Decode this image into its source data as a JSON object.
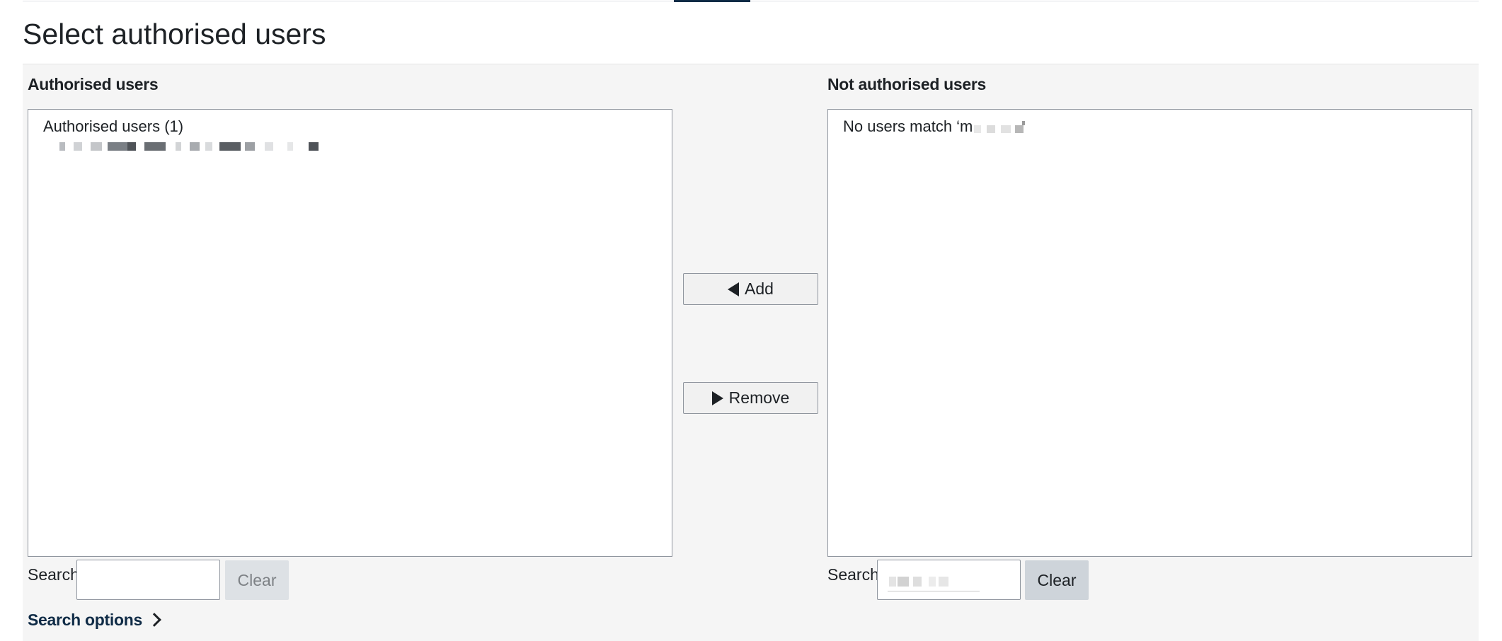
{
  "page": {
    "title": "Select authorised users"
  },
  "authorised": {
    "heading": "Authorised users",
    "group_label": "Authorised users (1)",
    "search_label": "Search",
    "search_value": "",
    "clear_label": "Clear"
  },
  "not_authorised": {
    "heading": "Not authorised users",
    "no_match_prefix": "No users match ‘m",
    "search_label": "Search",
    "clear_label": "Clear"
  },
  "actions": {
    "add_label": "Add",
    "remove_label": "Remove"
  },
  "search_options": {
    "label": "Search options"
  },
  "colors": {
    "accent": "#0f2b46",
    "panel_bg": "#f5f5f5",
    "border": "#8f959e",
    "clear_button": "#ced4da"
  },
  "icons": {
    "add": "triangle-left-icon",
    "remove": "triangle-right-icon",
    "search_options": "chevron-right-icon"
  }
}
